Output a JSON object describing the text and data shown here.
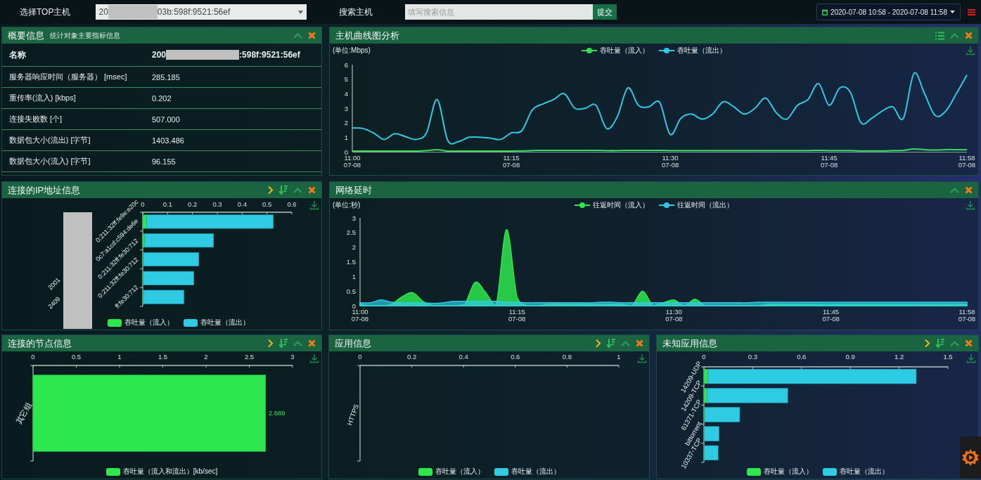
{
  "top_bar": {
    "host_label": "选择TOP主机",
    "host_select": {
      "value_parts": [
        "20",
        "03b:598f:9521:56ef"
      ]
    },
    "search_label": "搜索主机",
    "search": {
      "placeholder": "填写搜索信息"
    },
    "submit": "提交",
    "date_range": "2020-07-08 10:58 - 2020-07-08 11:58"
  },
  "summary": {
    "title": "概要信息",
    "subtitle": "统计对象主要指标信息",
    "header_row": {
      "label": "名称",
      "value_parts": [
        "200",
        ":598f:9521:56ef"
      ]
    },
    "rows": [
      {
        "label": "服务器响应时间（服务器） [msec]",
        "value": "285.185"
      },
      {
        "label": "重传率(流入) [kbps]",
        "value": "0.202"
      },
      {
        "label": "连接失败数 [个]",
        "value": "507.000"
      },
      {
        "label": "数据包大小(流出) [字节]",
        "value": "1403.486"
      },
      {
        "label": "数据包大小(流入) [字节]",
        "value": "96.155"
      }
    ]
  },
  "host_curve": {
    "title": "主机曲线图分析",
    "chart_data": {
      "type": "line",
      "ylabel": "(单位:Mbps)",
      "ylim": [
        0,
        6
      ],
      "yticks": [
        0,
        1,
        2,
        3,
        4,
        5,
        6
      ],
      "categories": [
        "11:00\n07-08",
        null,
        null,
        null,
        null,
        null,
        null,
        null,
        null,
        null,
        null,
        null,
        null,
        null,
        null,
        "11:15\n07-08",
        null,
        null,
        null,
        null,
        null,
        null,
        null,
        null,
        null,
        null,
        null,
        null,
        null,
        null,
        "11:30\n07-08",
        null,
        null,
        null,
        null,
        null,
        null,
        null,
        null,
        null,
        null,
        null,
        null,
        null,
        null,
        "11:45\n07-08",
        null,
        null,
        null,
        null,
        null,
        null,
        null,
        null,
        null,
        null,
        null,
        null,
        "11:58\n07-08"
      ],
      "series": [
        {
          "name": "吞吐量（流入）",
          "color": "#37e05a",
          "values": [
            0.05,
            0.05,
            0.05,
            0.05,
            0.05,
            0.05,
            0.05,
            0.08,
            0.15,
            0.05,
            0.05,
            0.05,
            0.05,
            0.05,
            0.05,
            0.05,
            0.06,
            0.08,
            0.1,
            0.1,
            0.1,
            0.1,
            0.1,
            0.1,
            0.08,
            0.08,
            0.1,
            0.1,
            0.1,
            0.1,
            0.08,
            0.08,
            0.08,
            0.08,
            0.08,
            0.08,
            0.08,
            0.08,
            0.08,
            0.08,
            0.08,
            0.08,
            0.08,
            0.08,
            0.1,
            0.08,
            0.08,
            0.08,
            0.06,
            0.06,
            0.06,
            0.08,
            0.1,
            0.2,
            0.15,
            0.12,
            0.15,
            0.15,
            0.15
          ]
        },
        {
          "name": "吞吐量（流出）",
          "color": "#2ecbe3",
          "values": [
            1.65,
            1.6,
            1.3,
            0.85,
            1.25,
            1.05,
            0.85,
            1.3,
            3.6,
            0.8,
            0.7,
            1.0,
            1.0,
            0.95,
            0.85,
            1.3,
            1.45,
            2.9,
            3.3,
            3.6,
            4.0,
            3.0,
            3.0,
            3.2,
            1.6,
            2.4,
            4.4,
            3.2,
            3.1,
            3.4,
            1.2,
            2.3,
            2.6,
            2.25,
            2.6,
            3.45,
            3.1,
            2.6,
            3.0,
            3.7,
            2.7,
            2.25,
            3.2,
            3.6,
            4.7,
            3.2,
            4.4,
            4.1,
            2.0,
            2.3,
            2.8,
            3.1,
            2.3,
            5.4,
            4.0,
            2.5,
            2.8,
            4.0,
            5.3
          ]
        }
      ]
    }
  },
  "latency": {
    "title": "网络延时",
    "chart_data": {
      "type": "area",
      "ylabel": "(单位:秒)",
      "ylim": [
        0,
        3
      ],
      "yticks": [
        0,
        0.5,
        1,
        1.5,
        2,
        2.5,
        3
      ],
      "categories": [
        "11:00\n07-08",
        null,
        null,
        null,
        null,
        null,
        null,
        null,
        null,
        null,
        null,
        null,
        null,
        null,
        null,
        "11:15\n07-08",
        null,
        null,
        null,
        null,
        null,
        null,
        null,
        null,
        null,
        null,
        null,
        null,
        null,
        null,
        "11:30\n07-08",
        null,
        null,
        null,
        null,
        null,
        null,
        null,
        null,
        null,
        null,
        null,
        null,
        null,
        null,
        "11:45\n07-08",
        null,
        null,
        null,
        null,
        null,
        null,
        null,
        null,
        null,
        null,
        null,
        null,
        "11:58\n07-08"
      ],
      "series": [
        {
          "name": "往返时间（流入）",
          "color": "#2ee64e",
          "values": [
            0.05,
            0,
            0,
            0.05,
            0.3,
            0.45,
            0.15,
            0,
            0,
            0,
            0.05,
            0.8,
            0.45,
            0,
            2.6,
            0.3,
            0,
            0,
            0.05,
            0.05,
            0.05,
            0.05,
            0.05,
            0.05,
            0.05,
            0.05,
            0,
            0.5,
            0,
            0.1,
            0.2,
            0,
            0.22,
            0,
            0,
            0,
            0,
            0,
            0,
            0.05,
            0.05,
            0.05,
            0.05,
            0.05,
            0.05,
            0.05,
            0.05,
            0.05,
            0.05,
            0.05,
            0.05,
            0.05,
            0.05,
            0.05,
            0.05,
            0.05,
            0.05,
            0.05,
            0.05
          ]
        },
        {
          "name": "往返时间（流出）",
          "color": "#2ecbe3",
          "values": [
            0.1,
            0.1,
            0.2,
            0.12,
            0.1,
            0.1,
            0.1,
            0.08,
            0.1,
            0.15,
            0.15,
            0.15,
            0.15,
            0.15,
            0.12,
            0.12,
            0.1,
            0.1,
            0.1,
            0.1,
            0.1,
            0.1,
            0.1,
            0.12,
            0.12,
            0.1,
            0.1,
            0.1,
            0.1,
            0.1,
            0.1,
            0.1,
            0.1,
            0.1,
            0.1,
            0.1,
            0.1,
            0.1,
            0.12,
            0.12,
            0.12,
            0.12,
            0.12,
            0.12,
            0.12,
            0.12,
            0.12,
            0.12,
            0.12,
            0.12,
            0.12,
            0.12,
            0.12,
            0.12,
            0.12,
            0.12,
            0.12,
            0.12,
            0.12
          ]
        }
      ]
    }
  },
  "ip_addresses": {
    "title": "连接的IP地址信息",
    "label_starts": [
      "2001",
      "2409"
    ],
    "chart_data": {
      "type": "bar",
      "orientation": "horizontal",
      "stacked": true,
      "categories": [
        "0:211:32ff:fe9e:e20c",
        "0c7:a1cd:c594:de6e",
        "0:211:32ff:fe30:712",
        "0:211:32ff:fe30:712",
        "ff:fe30:712"
      ],
      "xlim": [
        0,
        0.6
      ],
      "xticks": [
        0,
        0.1,
        0.2,
        0.3,
        0.4,
        0.5,
        0.6
      ],
      "series": [
        {
          "name": "吞吐量（流入）",
          "color": "#2ee64e",
          "values": [
            0.015,
            0.008,
            0.003,
            0.003,
            0.003
          ]
        },
        {
          "name": "吞吐量（流出）",
          "color": "#2ecbe3",
          "values": [
            0.51,
            0.277,
            0.222,
            0.202,
            0.162
          ]
        }
      ]
    }
  },
  "nodes": {
    "title": "连接的节点信息",
    "chart_data": {
      "type": "bar",
      "orientation": "horizontal",
      "data_labels": true,
      "categories": [
        "其它组"
      ],
      "xlim": [
        0,
        3
      ],
      "xticks": [
        0,
        0.5,
        1,
        1.5,
        2,
        2.5,
        3
      ],
      "series": [
        {
          "name": "吞吐量（流入和流出）[kb/sec]",
          "color": "#2ee64e",
          "values": [
            2.689
          ]
        }
      ]
    }
  },
  "applications": {
    "title": "应用信息",
    "chart_data": {
      "type": "bar",
      "orientation": "horizontal",
      "categories": [
        "HTTPS"
      ],
      "xlim": [
        0,
        1
      ],
      "xticks": [
        0,
        0.2,
        0.4,
        0.6,
        0.8,
        1
      ],
      "series": [
        {
          "name": "吞吐量（流入）",
          "color": "#2ee64e",
          "values": [
            0
          ]
        },
        {
          "name": "吞吐量（流出）",
          "color": "#2ecbe3",
          "values": [
            0
          ]
        }
      ]
    }
  },
  "unknown_applications": {
    "title": "未知应用信息",
    "chart_data": {
      "type": "bar",
      "orientation": "horizontal",
      "stacked": true,
      "categories": [
        "14209-UDP",
        "14209-TCP",
        "61371-TCP",
        "bittorrent",
        "10337-TCP"
      ],
      "xlim": [
        0,
        1.5
      ],
      "xticks": [
        0,
        0.3,
        0.6,
        0.9,
        1.2,
        1.5
      ],
      "series": [
        {
          "name": "吞吐量（流入）",
          "color": "#2ee64e",
          "values": [
            0.025,
            0.02,
            0.005,
            0.002,
            0.002
          ]
        },
        {
          "name": "吞吐量（流出）",
          "color": "#2ecbe3",
          "values": [
            1.28,
            0.495,
            0.215,
            0.09,
            0.085
          ]
        }
      ]
    }
  }
}
